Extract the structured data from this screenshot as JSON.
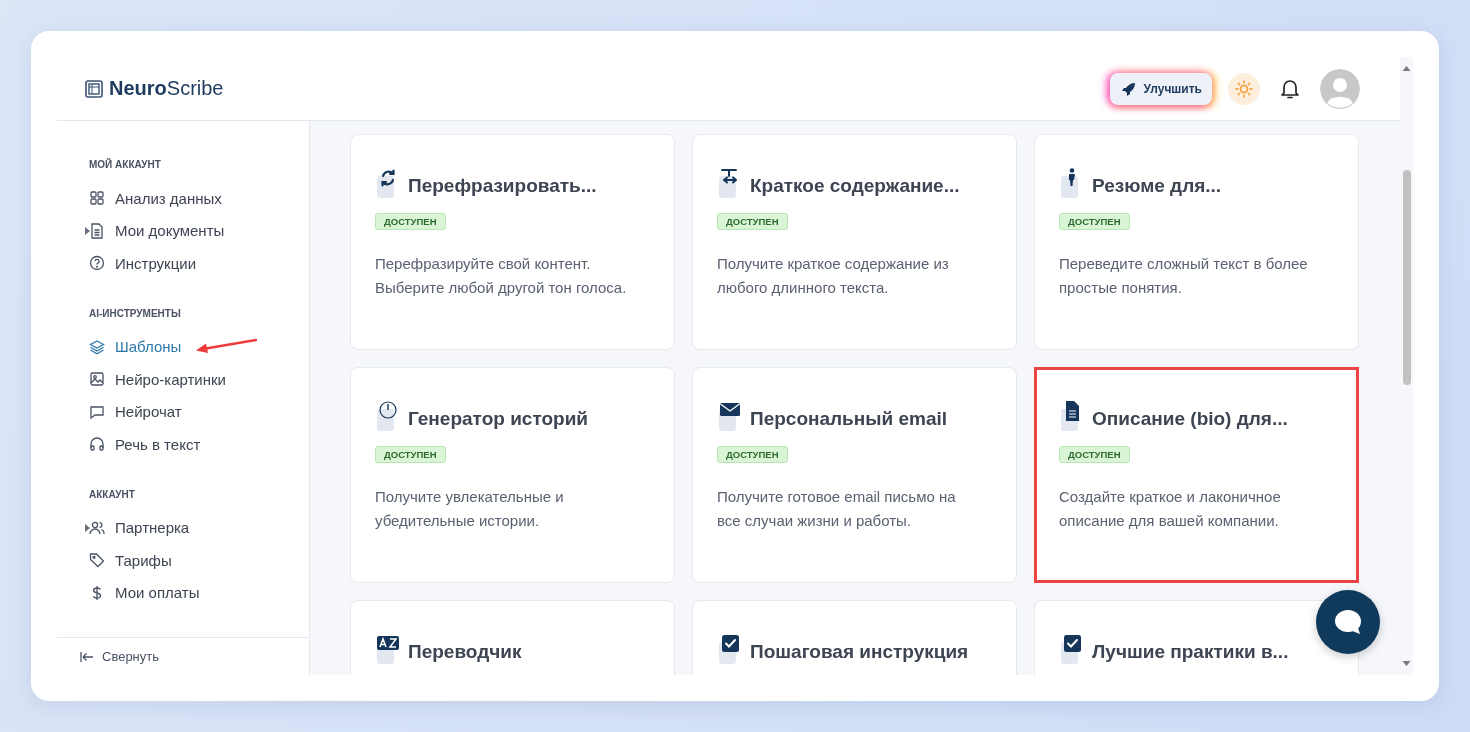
{
  "header": {
    "logo": {
      "bold": "Neuro",
      "regular": "Scribe"
    },
    "upgrade_button": "Улучшить"
  },
  "sidebar": {
    "sections": [
      {
        "title": "МОЙ АККАУНТ",
        "items": [
          {
            "label": "Анализ данных",
            "collapsible": false,
            "selected": false,
            "annotated": false
          },
          {
            "label": "Мои документы",
            "collapsible": true,
            "selected": false,
            "annotated": false
          },
          {
            "label": "Инструкции",
            "collapsible": false,
            "selected": false,
            "annotated": false
          }
        ]
      },
      {
        "title": "AI-ИНСТРУМЕНТЫ",
        "items": [
          {
            "label": "Шаблоны",
            "collapsible": false,
            "selected": true,
            "annotated": true
          },
          {
            "label": "Нейро-картинки",
            "collapsible": false,
            "selected": false,
            "annotated": false
          },
          {
            "label": "Нейрочат",
            "collapsible": false,
            "selected": false,
            "annotated": false
          },
          {
            "label": "Речь в текст",
            "collapsible": false,
            "selected": false,
            "annotated": false
          }
        ]
      },
      {
        "title": "АККАУНТ",
        "items": [
          {
            "label": "Партнерка",
            "collapsible": true,
            "selected": false,
            "annotated": false
          },
          {
            "label": "Тарифы",
            "collapsible": false,
            "selected": false,
            "annotated": false
          },
          {
            "label": "Мои оплаты",
            "collapsible": false,
            "selected": false,
            "annotated": false
          }
        ]
      }
    ],
    "collapse_button": "Свернуть"
  },
  "templates": [
    {
      "title": "Перефразировать...",
      "badge": "ДОСТУПЕН",
      "description": "Перефразируйте свой контент. Выберите любой другой тон голоса.",
      "highlighted": false
    },
    {
      "title": "Краткое содержание...",
      "badge": "ДОСТУПЕН",
      "description": "Получите краткое содержание из любого длинного текста.",
      "highlighted": false
    },
    {
      "title": "Резюме для...",
      "badge": "ДОСТУПЕН",
      "description": "Переведите сложный текст в более простые понятия.",
      "highlighted": false
    },
    {
      "title": "Генератор историй",
      "badge": "ДОСТУПЕН",
      "description": "Получите увлекательные и убедительные истории.",
      "highlighted": false
    },
    {
      "title": "Персональный email",
      "badge": "ДОСТУПЕН",
      "description": "Получите готовое email письмо на все случаи жизни и работы.",
      "highlighted": false
    },
    {
      "title": "Описание (bio) для...",
      "badge": "ДОСТУПЕН",
      "description": "Создайте краткое и лаконичное описание для вашей компании.",
      "highlighted": true
    },
    {
      "title": "Переводчик",
      "highlighted": false
    },
    {
      "title": "Пошаговая инструкция",
      "highlighted": false
    },
    {
      "title": "Лучшие практики в...",
      "highlighted": false
    }
  ]
}
